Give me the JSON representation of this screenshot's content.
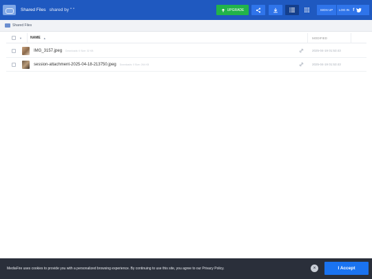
{
  "header": {
    "title": "Shared Files",
    "shared_by": "shared by \" \"",
    "upgrade_label": "UPGRADE",
    "sign_up_label": "SIGN UP",
    "log_in_label": "LOG IN"
  },
  "breadcrumb": {
    "label": "Shared Files"
  },
  "table": {
    "columns": {
      "name": "NAME",
      "modified": "MODIFIED"
    },
    "rows": [
      {
        "name": "IMG_3157.jpeg",
        "meta": "Downloads: 0  Size: 32 KB",
        "modified": "2025-04-19 01:53:43"
      },
      {
        "name": "session-attachment-2025-04-18-213750.jpeg",
        "meta": "Downloads: 0  Size: 264 KB",
        "modified": "2025-04-19 01:53:43"
      }
    ]
  },
  "cookie": {
    "text": "MediaFire uses cookies to provide you with a personalized browsing experience. By continuing to use this site, you agree to our Privacy Policy.",
    "accept_label": "I Accept"
  },
  "colors": {
    "header_bg": "#1f59c0",
    "upgrade_green": "#22b34a",
    "accent_blue": "#2f74ea",
    "cookie_bg": "#2a2f3a"
  },
  "icons": [
    "folder-logo-icon",
    "share-icon",
    "download-icon",
    "list-view-icon",
    "grid-view-icon",
    "facebook-icon",
    "twitter-icon",
    "link-icon",
    "close-icon"
  ]
}
